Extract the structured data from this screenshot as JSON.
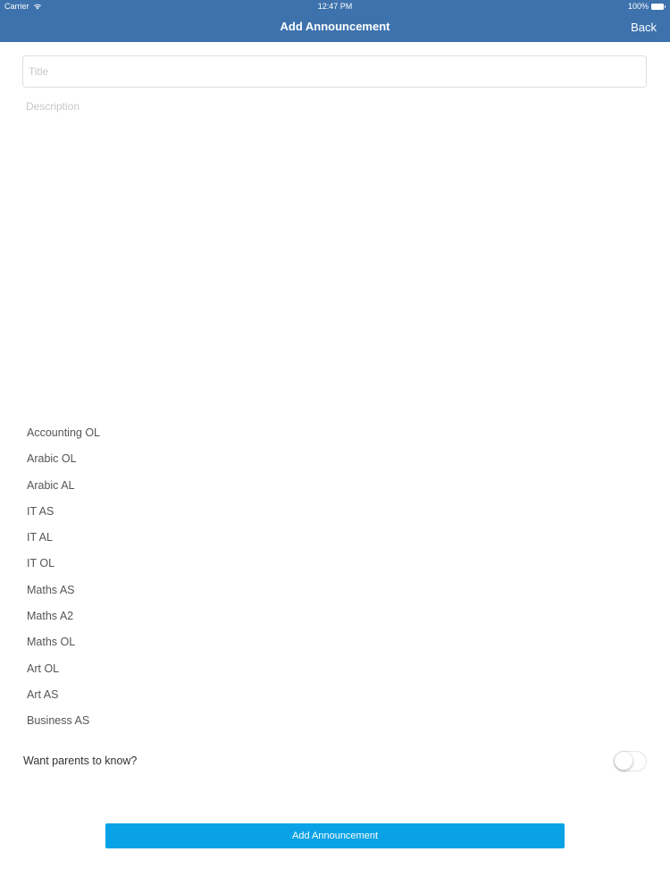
{
  "status_bar": {
    "carrier": "Carrier",
    "time": "12:47 PM",
    "battery": "100%"
  },
  "nav": {
    "title": "Add Announcement",
    "back_label": "Back"
  },
  "form": {
    "title_placeholder": "Title",
    "description_placeholder": "Description"
  },
  "subjects": [
    "Accounting OL",
    "Arabic OL",
    "Arabic AL",
    "IT AS",
    "IT AL",
    "IT OL",
    "Maths AS",
    "Maths A2",
    "Maths OL",
    "Art OL",
    "Art AS",
    "Business AS"
  ],
  "parents": {
    "label": "Want parents to know?",
    "enabled": false
  },
  "submit": {
    "label": "Add Announcement"
  },
  "colors": {
    "nav_bar": "#3d72ad",
    "primary_button": "#0aa2e6"
  }
}
